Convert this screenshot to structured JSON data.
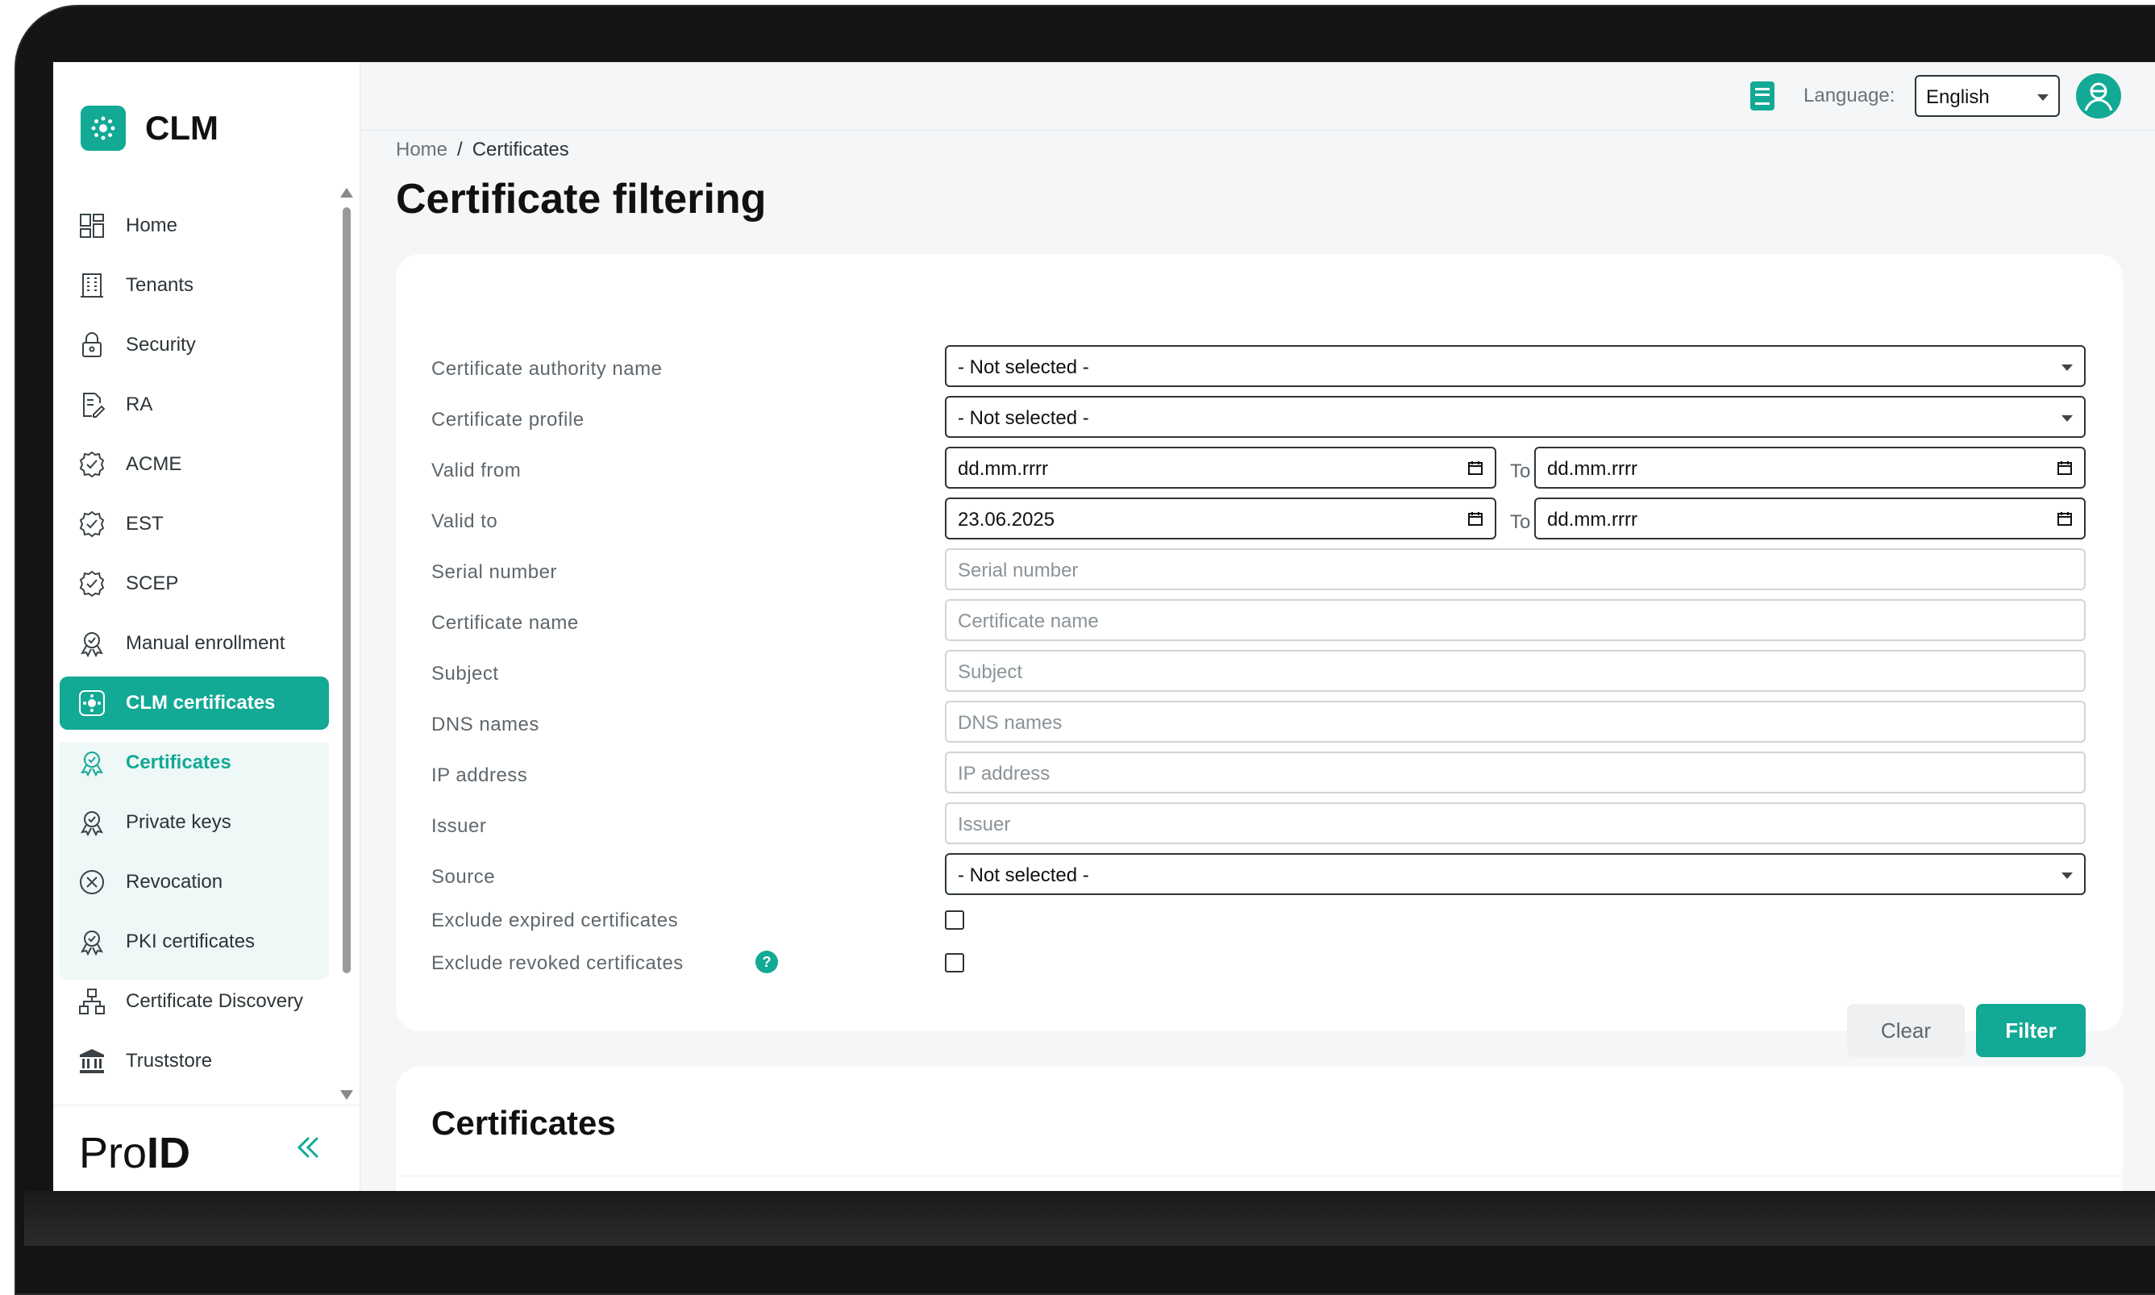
{
  "app": {
    "name": "CLM",
    "brand_footer_light": "Pro",
    "brand_footer_bold": "ID"
  },
  "topbar": {
    "language_label": "Language:",
    "language_value": "English"
  },
  "sidebar": {
    "items": [
      {
        "label": "Home",
        "icon": "dashboard-icon"
      },
      {
        "label": "Tenants",
        "icon": "building-icon"
      },
      {
        "label": "Security",
        "icon": "lock-icon"
      },
      {
        "label": "RA",
        "icon": "document-edit-icon"
      },
      {
        "label": "ACME",
        "icon": "badge-check-icon"
      },
      {
        "label": "EST",
        "icon": "badge-check-icon"
      },
      {
        "label": "SCEP",
        "icon": "badge-check-icon"
      },
      {
        "label": "Manual enrollment",
        "icon": "certificate-icon"
      },
      {
        "label": "CLM certificates",
        "icon": "clm-icon",
        "active": true
      },
      {
        "label": "Certificates",
        "icon": "certificate-icon"
      },
      {
        "label": "Private keys",
        "icon": "certificate-icon"
      },
      {
        "label": "Revocation",
        "icon": "revoke-icon"
      },
      {
        "label": "PKI certificates",
        "icon": "certificate-icon"
      },
      {
        "label": "Certificate Discovery",
        "icon": "network-icon"
      },
      {
        "label": "Truststore",
        "icon": "bank-icon"
      }
    ]
  },
  "breadcrumb": {
    "home": "Home",
    "separator": "/",
    "current": "Certificates"
  },
  "page_title": "Certificate filtering",
  "filters": {
    "ca_name": {
      "label": "Certificate authority name",
      "value": "- Not selected -"
    },
    "profile": {
      "label": "Certificate profile",
      "value": "- Not selected -"
    },
    "valid_from": {
      "label": "Valid from",
      "from": "dd.mm.rrrr",
      "to_label": "To",
      "to": "dd.mm.rrrr"
    },
    "valid_to": {
      "label": "Valid to",
      "from": "23.06.2025",
      "to_label": "To",
      "to": "dd.mm.rrrr"
    },
    "serial": {
      "label": "Serial number",
      "placeholder": "Serial number"
    },
    "cert_name": {
      "label": "Certificate name",
      "placeholder": "Certificate name"
    },
    "subject": {
      "label": "Subject",
      "placeholder": "Subject"
    },
    "dns": {
      "label": "DNS names",
      "placeholder": "DNS names"
    },
    "ip": {
      "label": "IP address",
      "placeholder": "IP address"
    },
    "issuer": {
      "label": "Issuer",
      "placeholder": "Issuer"
    },
    "source": {
      "label": "Source",
      "value": "- Not selected -"
    },
    "exclude_expired": {
      "label": "Exclude expired certificates",
      "checked": false
    },
    "exclude_revoked": {
      "label": "Exclude revoked certificates",
      "checked": false,
      "help": "?"
    }
  },
  "buttons": {
    "clear": "Clear",
    "filter": "Filter"
  },
  "results": {
    "title": "Certificates"
  },
  "colors": {
    "accent": "#12a995",
    "text": "#2d3438"
  }
}
